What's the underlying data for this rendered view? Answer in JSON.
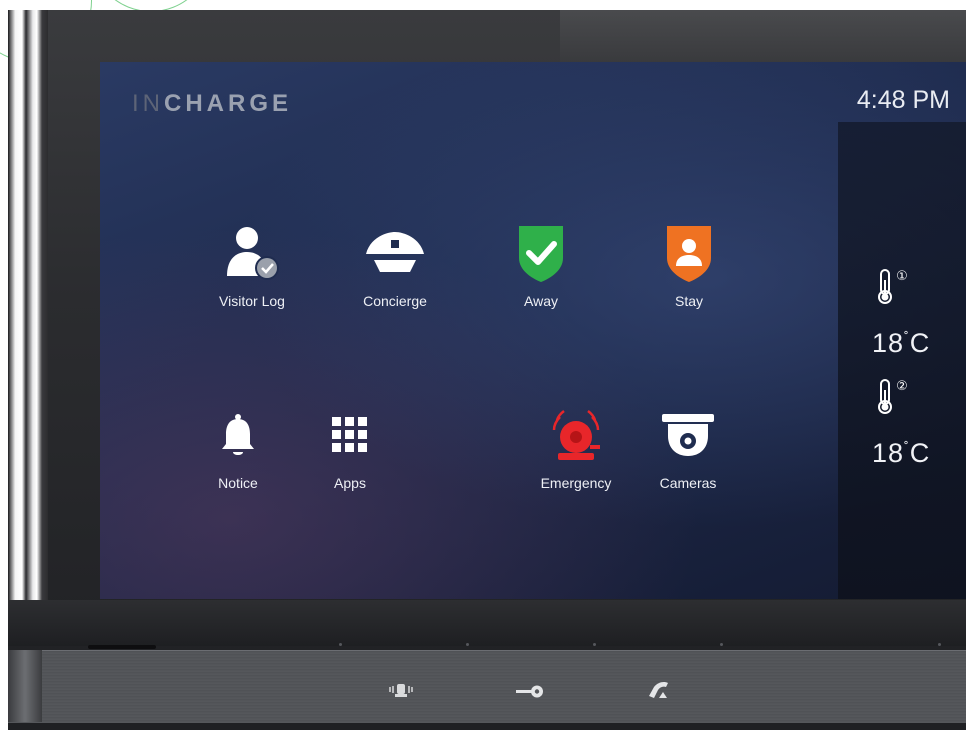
{
  "brand": {
    "prefix": "IN",
    "name": "CHARGE"
  },
  "clock": "4:48 PM",
  "apps": [
    {
      "label": "Visitor Log",
      "icon": "visitor-log-icon"
    },
    {
      "label": "Concierge",
      "icon": "concierge-icon"
    },
    {
      "label": "Away",
      "icon": "away-shield-icon"
    },
    {
      "label": "Stay",
      "icon": "stay-shield-icon"
    },
    {
      "label": "Notice",
      "icon": "bell-icon"
    },
    {
      "label": "Apps",
      "icon": "apps-grid-icon"
    },
    {
      "label": "Emergency",
      "icon": "alarm-bell-icon"
    },
    {
      "label": "Cameras",
      "icon": "camera-icon"
    }
  ],
  "temperatures": [
    {
      "sensor": "①",
      "value": "18",
      "unit": "C"
    },
    {
      "sensor": "②",
      "value": "18",
      "unit": "C"
    }
  ],
  "hardware_buttons": [
    {
      "icon": "intercom-icon"
    },
    {
      "icon": "key-unlock-icon"
    },
    {
      "icon": "phone-hangup-icon"
    }
  ],
  "colors": {
    "away_green": "#2fb04a",
    "stay_orange": "#ef7222",
    "emergency_red": "#e8262a"
  }
}
